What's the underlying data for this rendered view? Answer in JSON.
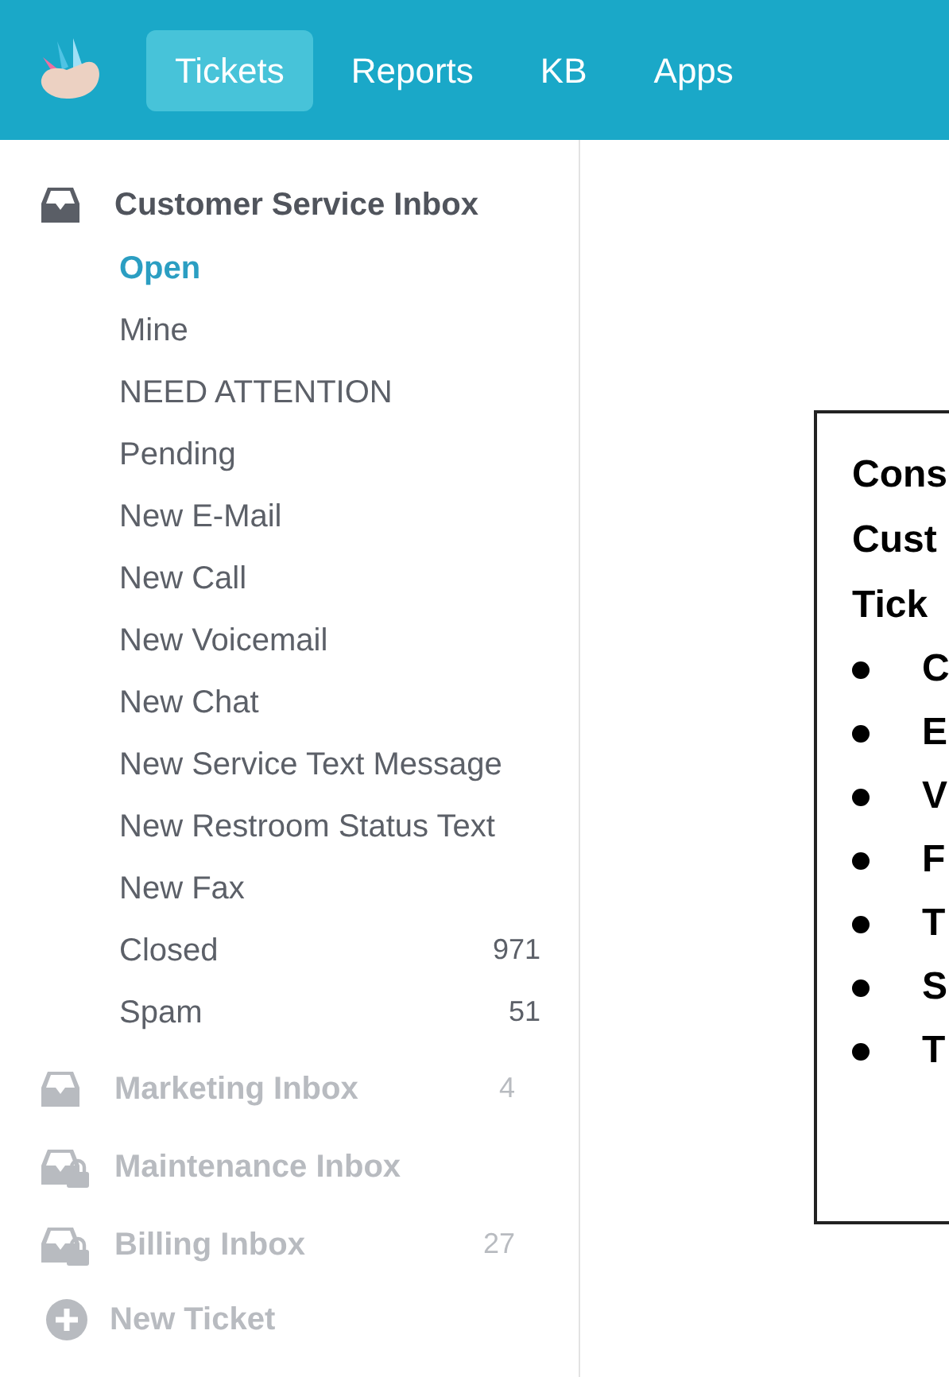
{
  "nav": {
    "tabs": [
      {
        "label": "Tickets",
        "selected": true
      },
      {
        "label": "Reports",
        "selected": false
      },
      {
        "label": "KB",
        "selected": false
      },
      {
        "label": "Apps",
        "selected": false
      }
    ]
  },
  "sidebar": {
    "inboxes": [
      {
        "name": "Customer Service Inbox",
        "locked": false,
        "expanded": true,
        "views": [
          {
            "label": "Open",
            "selected": true
          },
          {
            "label": "Mine",
            "selected": false
          },
          {
            "label": "NEED ATTENTION",
            "selected": false
          },
          {
            "label": "Pending",
            "selected": false
          },
          {
            "label": "New E-Mail",
            "selected": false
          },
          {
            "label": "New Call",
            "selected": false
          },
          {
            "label": "New Voicemail",
            "selected": false
          },
          {
            "label": "New Chat",
            "selected": false
          },
          {
            "label": "New Service Text Message",
            "selected": false
          },
          {
            "label": "New Restroom Status Text",
            "selected": false
          },
          {
            "label": "New Fax",
            "selected": false
          },
          {
            "label": "Closed",
            "selected": false,
            "count": "971"
          },
          {
            "label": "Spam",
            "selected": false,
            "count": "51"
          }
        ]
      },
      {
        "name": "Marketing Inbox",
        "locked": false,
        "expanded": false,
        "count": "4"
      },
      {
        "name": "Maintenance Inbox",
        "locked": true,
        "expanded": false
      },
      {
        "name": "Billing Inbox",
        "locked": true,
        "expanded": false,
        "count": "27"
      }
    ],
    "new_ticket": "New Ticket"
  },
  "callout": {
    "lines": [
      "Cons",
      "Cust",
      "Tick"
    ],
    "bullets": [
      "C",
      "E",
      "V",
      "F",
      "T",
      "S",
      "T"
    ]
  }
}
